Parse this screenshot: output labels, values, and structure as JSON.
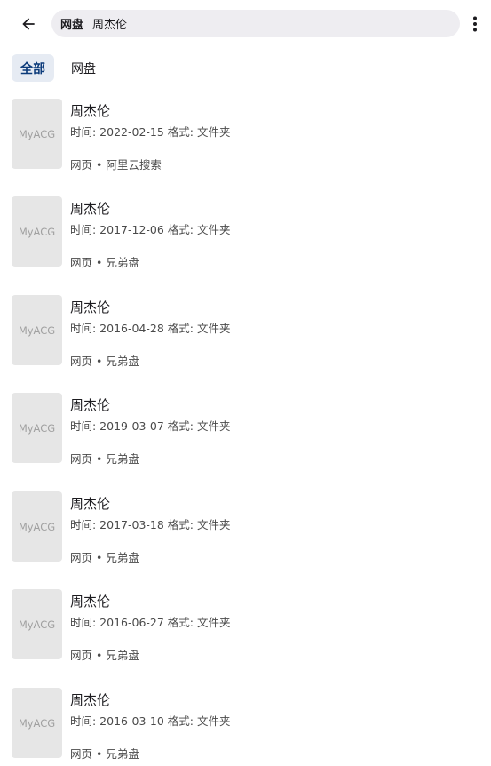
{
  "search": {
    "scope": "网盘",
    "query": "周杰伦"
  },
  "tabs": [
    {
      "label": "全部",
      "active": true
    },
    {
      "label": "网盘",
      "active": false
    }
  ],
  "results": [
    {
      "thumb": "MyACG",
      "title": "周杰伦",
      "meta": "时间: 2022-02-15 格式: 文件夹",
      "type": "网页",
      "sep": "•",
      "source": "阿里云搜索"
    },
    {
      "thumb": "MyACG",
      "title": "周杰伦",
      "meta": "时间: 2017-12-06 格式: 文件夹",
      "type": "网页",
      "sep": "•",
      "source": "兄弟盘"
    },
    {
      "thumb": "MyACG",
      "title": "周杰伦",
      "meta": "时间: 2016-04-28 格式: 文件夹",
      "type": "网页",
      "sep": "•",
      "source": "兄弟盘"
    },
    {
      "thumb": "MyACG",
      "title": "周杰伦",
      "meta": "时间: 2019-03-07 格式: 文件夹",
      "type": "网页",
      "sep": "•",
      "source": "兄弟盘"
    },
    {
      "thumb": "MyACG",
      "title": "周杰伦",
      "meta": "时间: 2017-03-18 格式: 文件夹",
      "type": "网页",
      "sep": "•",
      "source": "兄弟盘"
    },
    {
      "thumb": "MyACG",
      "title": "周杰伦",
      "meta": "时间: 2016-06-27 格式: 文件夹",
      "type": "网页",
      "sep": "•",
      "source": "兄弟盘"
    },
    {
      "thumb": "MyACG",
      "title": "周杰伦",
      "meta": "时间: 2016-03-10 格式: 文件夹",
      "type": "网页",
      "sep": "•",
      "source": "兄弟盘"
    }
  ],
  "icons": {
    "back": "arrow-left-icon",
    "more": "more-vertical-icon"
  },
  "colors": {
    "accent": "#0b3a7a",
    "active_tab_bg": "#e6ebf3",
    "search_bg": "#eeedf1",
    "thumb_bg": "#e6e6e6"
  }
}
